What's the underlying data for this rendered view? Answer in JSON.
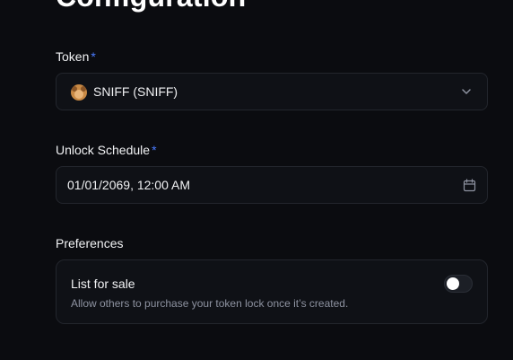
{
  "section": {
    "heading": "Configuration"
  },
  "token_field": {
    "label": "Token",
    "required_mark": "*",
    "selected": "SNIFF (SNIFF)",
    "icon": "token-avatar-icon",
    "dropdown_icon": "chevron-down-icon"
  },
  "unlock_field": {
    "label": "Unlock Schedule",
    "required_mark": "*",
    "value": "01/01/2069, 12:00 AM",
    "icon": "calendar-icon"
  },
  "preferences": {
    "label": "Preferences",
    "list_for_sale": {
      "title": "List for sale",
      "description": "Allow others to purchase your token lock once it’s created.",
      "enabled": false
    }
  },
  "colors": {
    "background": "#0b0c10",
    "field_bg": "#0f1116",
    "border": "#23262d",
    "required": "#4a7bff",
    "muted_text": "#8e93a1"
  }
}
